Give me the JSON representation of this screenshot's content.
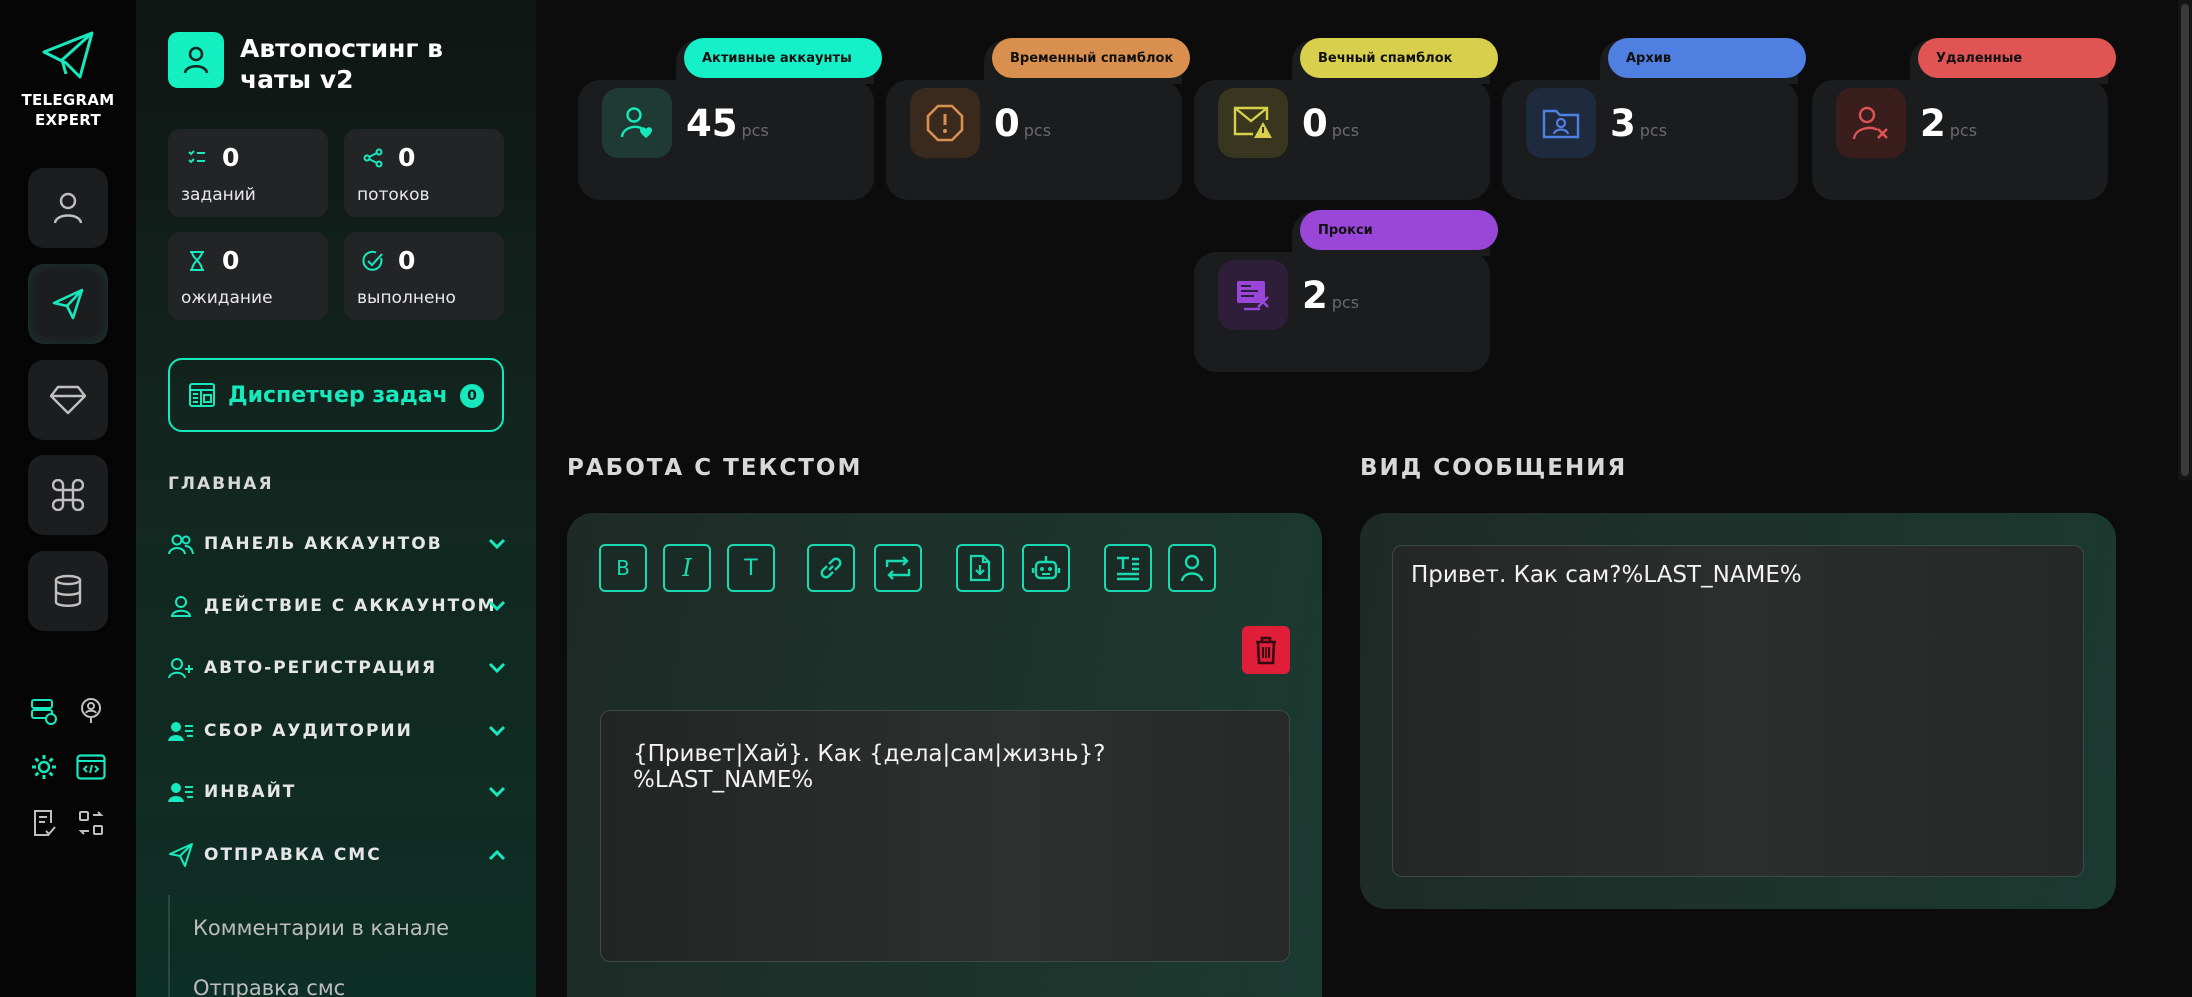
{
  "brand": {
    "line1": "TELEGRAM",
    "line2": "EXPERT"
  },
  "project": {
    "title": "Автопостинг в чаты v2"
  },
  "stats": [
    {
      "icon": "task-list-icon",
      "value": "0",
      "label": "заданий"
    },
    {
      "icon": "share-icon",
      "value": "0",
      "label": "потоков"
    },
    {
      "icon": "hourglass-icon",
      "value": "0",
      "label": "ожидание"
    },
    {
      "icon": "check-circle-icon",
      "value": "0",
      "label": "выполнено"
    }
  ],
  "dispatcher": {
    "label": "Диспетчер задач",
    "count": "0"
  },
  "nav": {
    "section": "ГЛАВНАЯ",
    "items": [
      {
        "label": "ПАНЕЛЬ АККАУНТОВ",
        "icon": "users-icon",
        "expanded": false
      },
      {
        "label": "ДЕЙСТВИЕ С АККАУНТОМ",
        "icon": "user-icon",
        "expanded": false
      },
      {
        "label": "АВТО-РЕГИСТРАЦИЯ",
        "icon": "user-plus-icon",
        "expanded": false
      },
      {
        "label": "СБОР АУДИТОРИИ",
        "icon": "audience-icon",
        "expanded": false
      },
      {
        "label": "ИНВАЙТ",
        "icon": "invite-icon",
        "expanded": false
      },
      {
        "label": "ОТПРАВКА СМС",
        "icon": "send-icon",
        "expanded": true
      }
    ],
    "subitems": [
      "Комментарии в канале",
      "Отправка смс"
    ]
  },
  "accounts": {
    "unit": "pcs",
    "cards": [
      {
        "tab": "Активные аккаунты",
        "value": "45",
        "color": "#16f0c8",
        "icon": "user-heart-icon"
      },
      {
        "tab": "Временный спамблок",
        "value": "0",
        "color": "#d98f4d",
        "icon": "alert-octagon-icon"
      },
      {
        "tab": "Вечный спамблок",
        "value": "0",
        "color": "#d8cf4d",
        "icon": "mail-warning-icon"
      },
      {
        "tab": "Архив",
        "value": "3",
        "color": "#4f7fe0",
        "icon": "folder-user-icon"
      },
      {
        "tab": "Удаленные",
        "value": "2",
        "color": "#e05454",
        "icon": "user-x-icon"
      },
      {
        "tab": "Прокси",
        "value": "2",
        "color": "#9a47d9",
        "icon": "proxy-icon"
      }
    ]
  },
  "text_work": {
    "heading": "РАБОТА С ТЕКСТОМ",
    "editor_text": "{Привет|Хай}. Как {дела|сам|жизнь}?%LAST_NAME%"
  },
  "message_view": {
    "heading": "ВИД СООБЩЕНИЯ",
    "text": "Привет. Как сам?%LAST_NAME%"
  }
}
